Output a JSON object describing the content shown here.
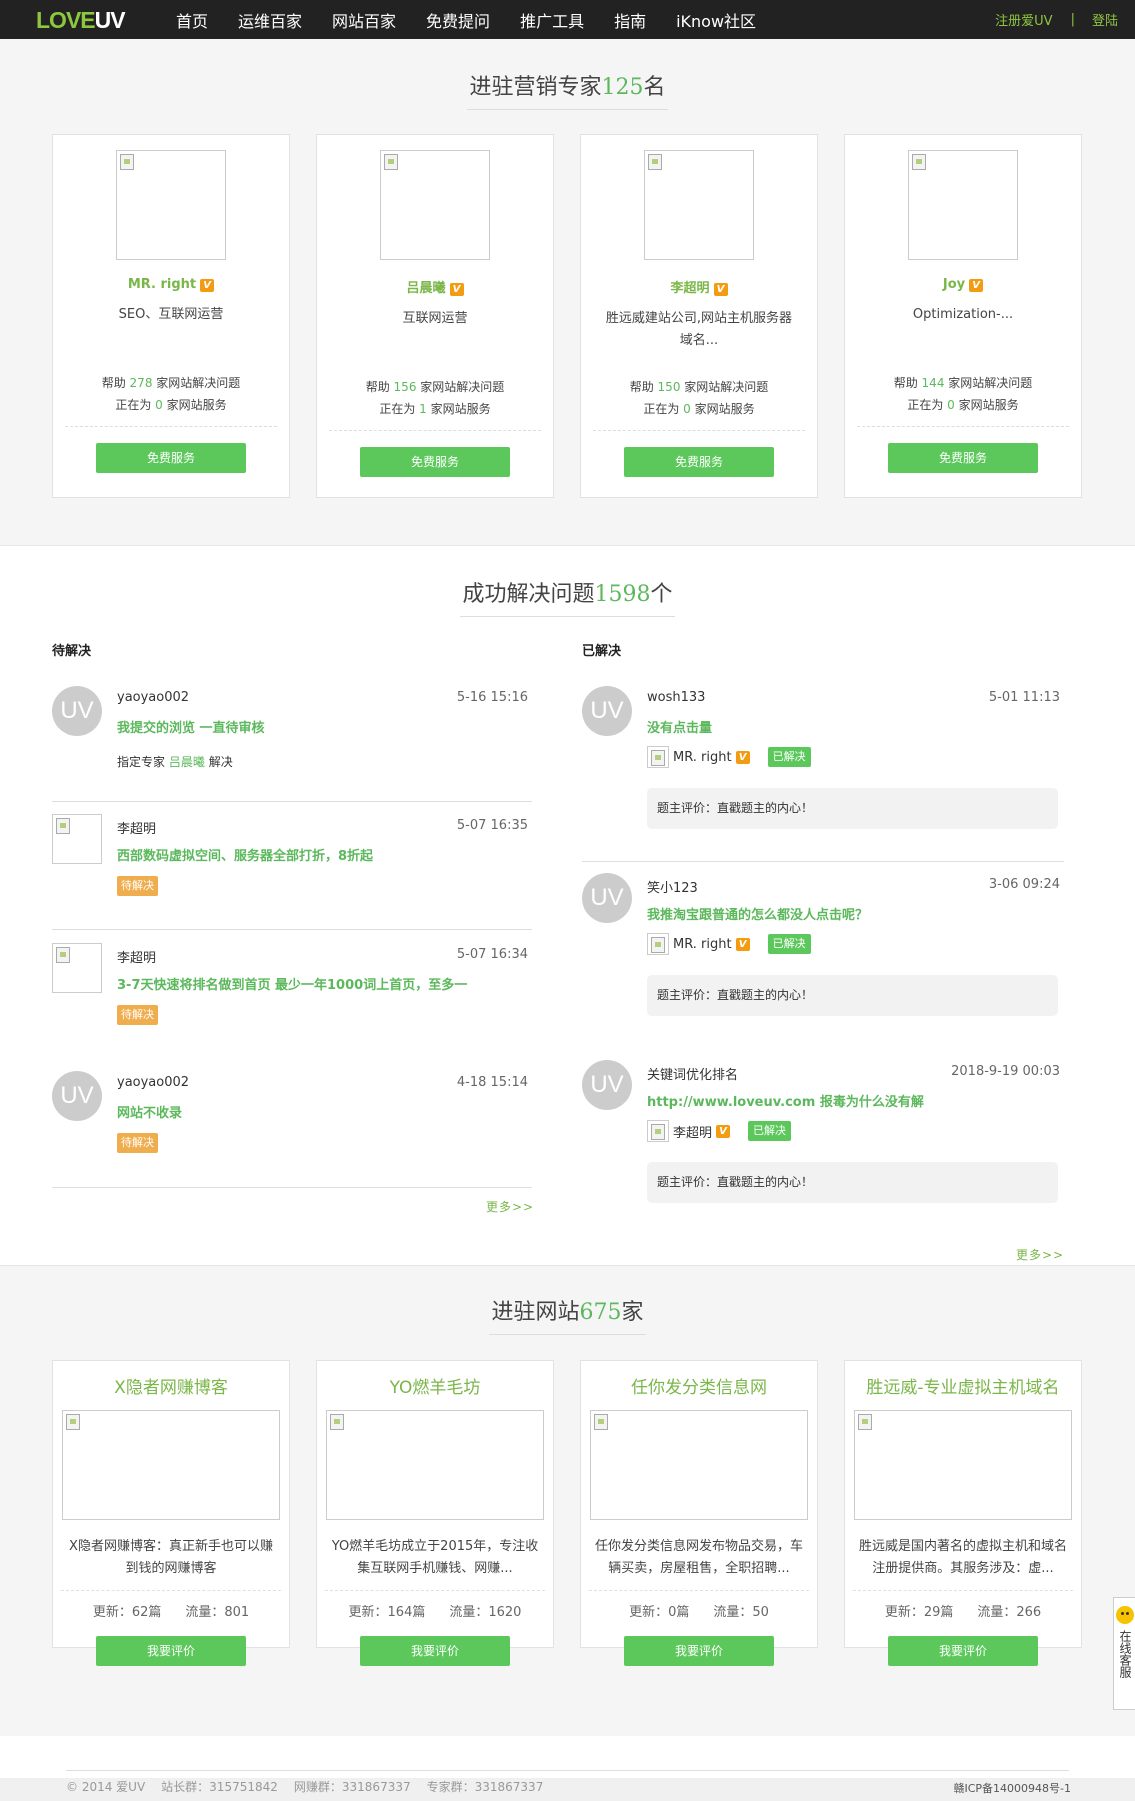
{
  "nav": {
    "logo_left": "LOVE",
    "logo_right": "UV",
    "items": [
      "首页",
      "运维百家",
      "网站百家",
      "免费提问",
      "推广工具",
      "指南",
      "iKnow社区"
    ],
    "register": "注册爱UV",
    "separator": "|",
    "login": "登陆"
  },
  "experts": {
    "title_prefix": "进驻营销专家",
    "count": "125",
    "title_suffix": "名",
    "cards": [
      {
        "name": "MR. right",
        "desc": "SEO、互联网运营",
        "help_count": "278",
        "serving": "0",
        "button": "免费服务"
      },
      {
        "name": "吕晨曦",
        "desc": "互联网运营",
        "help_count": "156",
        "serving": "1",
        "button": "免费服务"
      },
      {
        "name": "李超明",
        "desc": "胜远威建站公司,网站主机服务器域名...",
        "help_count": "150",
        "serving": "0",
        "button": "免费服务"
      },
      {
        "name": "Joy",
        "desc": "Optimization-...",
        "help_count": "144",
        "serving": "0",
        "button": "免费服务"
      }
    ],
    "help_prefix": "帮助",
    "help_suffix": "家网站解决问题",
    "serving_prefix": "正在为",
    "serving_suffix": "家网站服务",
    "v_badge": "V"
  },
  "questions": {
    "title_prefix": "成功解决问题",
    "count": "1598",
    "title_suffix": "个",
    "pending_header": "待解决",
    "solved_header": "已解决",
    "pending": [
      {
        "user": "yaoyao002",
        "time": "5-16 15:16",
        "title": "我提交的浏览 一直待审核",
        "extra_prefix": "指定专家",
        "extra_expert": "吕晨曦",
        "extra_suffix": "解决"
      },
      {
        "user": "李超明",
        "time": "5-07 16:35",
        "title": "西部数码虚拟空间、服务器全部打折，8折起",
        "tag": "待解决"
      },
      {
        "user": "李超明",
        "time": "5-07 16:34",
        "title": "3-7天快速将排名做到首页 最少一年1000词上首页，至多一",
        "tag": "待解决"
      },
      {
        "user": "yaoyao002",
        "time": "4-18 15:14",
        "title": "网站不收录",
        "tag": "待解决"
      }
    ],
    "solved": [
      {
        "user": "wosh133",
        "time": "5-01 11:13",
        "title": "没有点击量",
        "expert": "MR. right",
        "tag": "已解决",
        "comment": "题主评价：直戳题主的内心！"
      },
      {
        "user": "笑小123",
        "time": "3-06 09:24",
        "title": "我推淘宝跟普通的怎么都没人点击呢？",
        "expert": "MR. right",
        "tag": "已解决",
        "comment": "题主评价：直戳题主的内心！"
      },
      {
        "user": "关键词优化排名",
        "time": "2018-9-19 00:03",
        "title": "http://www.loveuv.com 报毒为什么没有解",
        "expert": "李超明",
        "tag": "已解决",
        "comment": "题主评价：直戳题主的内心！"
      }
    ],
    "more": "更多>>",
    "uv_avatar": "UV"
  },
  "sites": {
    "title_prefix": "进驻网站",
    "count": "675",
    "title_suffix": "家",
    "cards": [
      {
        "name": "X隐者网赚博客",
        "desc": "X隐者网赚博客：真正新手也可以赚到钱的网赚博客",
        "updates": "更新：62篇",
        "traffic": "流量：801",
        "button": "我要评价"
      },
      {
        "name": "YO燃羊毛坊",
        "desc": "YO燃羊毛坊成立于2015年，专注收集互联网手机赚钱、网赚...",
        "updates": "更新：164篇",
        "traffic": "流量：1620",
        "button": "我要评价"
      },
      {
        "name": "任你发分类信息网",
        "desc": "任你发分类信息网发布物品交易，车辆买卖，房屋租售，全职招聘...",
        "updates": "更新：0篇",
        "traffic": "流量：50",
        "button": "我要评价"
      },
      {
        "name": "胜远威-专业虚拟主机域名",
        "desc": "胜远威是国内著名的虚拟主机和域名注册提供商。其服务涉及：虚...",
        "updates": "更新：29篇",
        "traffic": "流量：266",
        "button": "我要评价"
      }
    ]
  },
  "footer": {
    "copyright": "© 2014 爱UV",
    "group1": "站长群：315751842",
    "group2": "网赚群：331867337",
    "group3": "专家群：331867337",
    "icp": "赣ICP备14000948号-1"
  },
  "side_widget": {
    "label": "在线客服"
  },
  "colors": {
    "accent_green": "#5cb85c",
    "button_green": "#5cc85c",
    "pending_orange": "#f0ad4e",
    "nav_bg": "#222222"
  }
}
